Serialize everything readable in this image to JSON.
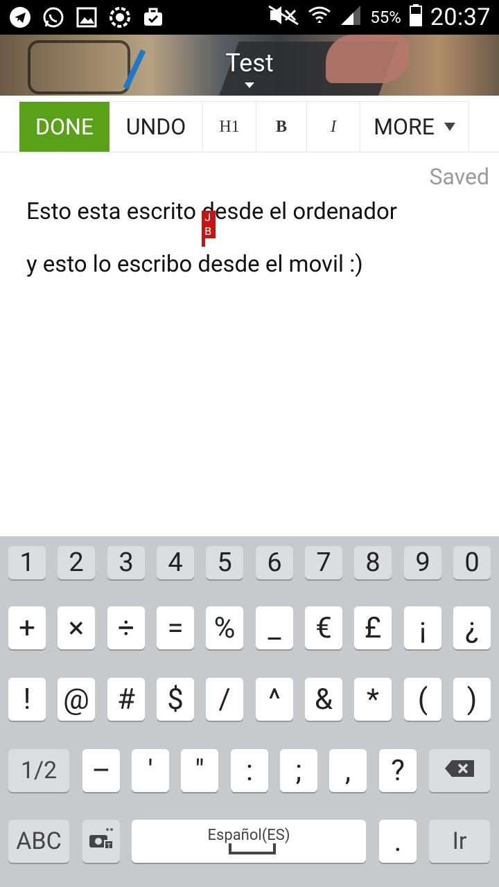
{
  "status_bar": {
    "battery_percent": "55%",
    "time": "20:37",
    "left_icons": [
      "telegram-icon",
      "whatsapp-icon",
      "gallery-icon",
      "settings-icon",
      "briefcase-icon"
    ],
    "right_icons": [
      "mute-icon",
      "wifi-icon",
      "signal-icon",
      "battery-icon"
    ]
  },
  "header": {
    "title": "Test"
  },
  "toolbar": {
    "done_label": "DONE",
    "undo_label": "UNDO",
    "h1_label": "H1",
    "bold_label": "B",
    "italic_label": "I",
    "more_label": "MORE",
    "done_color": "#5aa11a"
  },
  "editor": {
    "status": "Saved",
    "line1_before_cursor": "Esto esta escrito ",
    "line1_after_cursor": "desde el ordenador",
    "line2": "y esto lo escribo desde el movil :)",
    "collaborator_initials": "J B",
    "collaborator_color": "#c41414"
  },
  "keyboard": {
    "row1": [
      "1",
      "2",
      "3",
      "4",
      "5",
      "6",
      "7",
      "8",
      "9",
      "0"
    ],
    "row2": [
      "+",
      "×",
      "÷",
      "=",
      "%",
      "_",
      "€",
      "£",
      "¡",
      "¿"
    ],
    "row3": [
      "!",
      "@",
      "#",
      "$",
      "/",
      "^",
      "&",
      "*",
      "(",
      ")"
    ],
    "row4": [
      "1/2",
      "–",
      "'",
      "\"",
      ":",
      ";",
      ",",
      "?"
    ],
    "abc_label": "ABC",
    "space_language": "Español(ES)",
    "period_label": ".",
    "go_label": "Ir"
  }
}
